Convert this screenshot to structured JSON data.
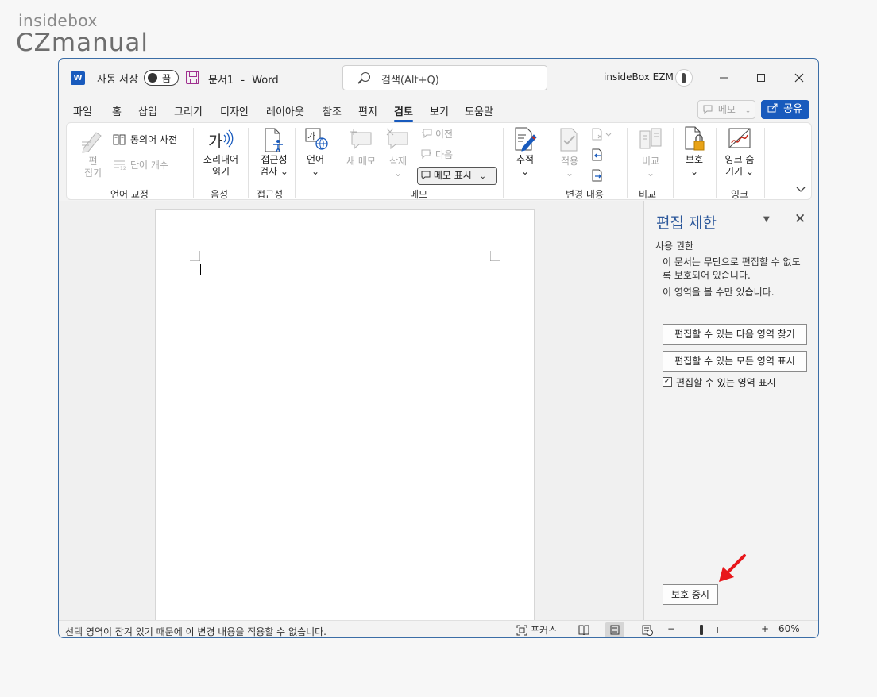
{
  "brand": {
    "line1": "insidebox",
    "line2": "CZmanual"
  },
  "titlebar": {
    "autosave_label": "자동 저장",
    "autosave_state": "끔",
    "doc_name": "문서1",
    "separator": "-",
    "app_name": "Word",
    "search_placeholder": "검색(Alt+Q)",
    "user_name": "insideBox EZM"
  },
  "tabs": [
    "파일",
    "홈",
    "삽입",
    "그리기",
    "디자인",
    "레이아웃",
    "참조",
    "편지",
    "검토",
    "보기",
    "도움말"
  ],
  "active_tab": "검토",
  "actions": {
    "memo": "메모",
    "share": "공유"
  },
  "ribbon": {
    "proofing": {
      "edit_1": "편",
      "edit_2": "집기",
      "thesaurus": "동의어 사전",
      "word_count": "단어 개수",
      "label": "언어 교정"
    },
    "speech": {
      "read_1": "소리내어",
      "read_2": "읽기",
      "label": "음성"
    },
    "accessibility": {
      "check_1": "접근성",
      "check_2": "검사",
      "label": "접근성"
    },
    "language": {
      "lang": "언어"
    },
    "comments": {
      "new_1": "새 메모",
      "delete": "삭제",
      "prev": "이전",
      "next": "다음",
      "show": "메모 표시",
      "label": "메모"
    },
    "tracking": {
      "track": "추적"
    },
    "changes": {
      "accept": "적용",
      "label": "변경 내용"
    },
    "compare": {
      "compare": "비교",
      "label": "비교"
    },
    "protect": {
      "protect": "보호"
    },
    "ink": {
      "ink_1": "잉크 숨",
      "ink_2": "기기",
      "label": "잉크"
    }
  },
  "pane": {
    "title": "편집 제한",
    "section": "사용 권한",
    "desc": "이 문서는 무단으로 편집할 수 없도록 보호되어 있습니다.",
    "note": "이 영역을 볼 수만 있습니다.",
    "find_next": "편집할 수 있는 다음 영역 찾기",
    "show_all": "편집할 수 있는 모든 영역 표시",
    "highlight_label": "편집할 수 있는 영역 표시",
    "highlight_checked": true,
    "stop_protection": "보호 중지"
  },
  "status": {
    "message": "선택 영역이 잠겨 있기 때문에 이 변경 내용을 적용할 수 없습니다.",
    "focus": "포커스",
    "zoom_minus": "−",
    "zoom_plus": "+",
    "zoom": "60%"
  },
  "colors": {
    "accent": "#185abd",
    "pane_title": "#2b579a",
    "arrow": "#e8171b",
    "border": "#3b6da6"
  }
}
